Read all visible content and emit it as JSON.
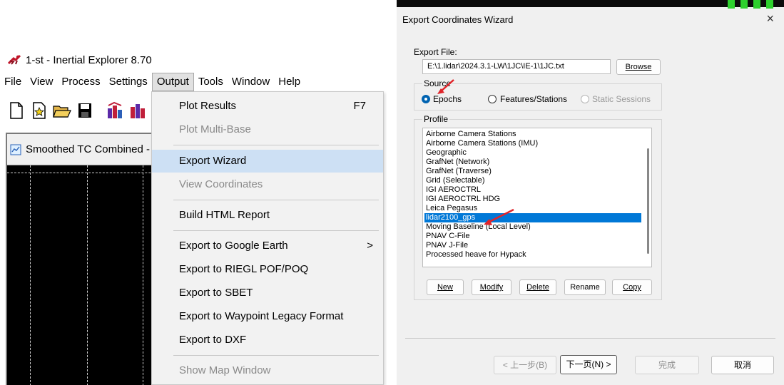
{
  "left": {
    "app_title": "1-st - Inertial Explorer 8.70",
    "menubar": [
      "File",
      "View",
      "Process",
      "Settings",
      "Output",
      "Tools",
      "Window",
      "Help"
    ],
    "active_menu": "Output",
    "doc_window_title": "Smoothed TC Combined - M",
    "dropdown": {
      "items": [
        {
          "label": "Plot Results",
          "shortcut": "F7",
          "enabled": true
        },
        {
          "label": "Plot Multi-Base",
          "enabled": false
        },
        {
          "label": "Export Wizard",
          "enabled": true,
          "highlighted": true
        },
        {
          "label": "View Coordinates",
          "enabled": false
        },
        {
          "label": "Build HTML Report",
          "enabled": true
        },
        {
          "label": "Export to Google Earth",
          "enabled": true,
          "submenu": ">"
        },
        {
          "label": "Export to RIEGL POF/POQ",
          "enabled": true
        },
        {
          "label": "Export to SBET",
          "enabled": true
        },
        {
          "label": "Export to Waypoint Legacy Format",
          "enabled": true
        },
        {
          "label": "Export to DXF",
          "enabled": true
        },
        {
          "label": "Show Map Window",
          "enabled": false
        }
      ]
    }
  },
  "right": {
    "dialog_title": "Export Coordinates Wizard",
    "close_symbol": "×",
    "export_file_label": "Export File:",
    "export_file_value": "E:\\1.lidar\\2024.3.1-LW\\1JC\\IE-1\\1JC.txt",
    "browse_button": "Browse",
    "source_label": "Source",
    "source_options": [
      {
        "label": "Epochs",
        "selected": true,
        "enabled": true
      },
      {
        "label": "Features/Stations",
        "selected": false,
        "enabled": true
      },
      {
        "label": "Static Sessions",
        "selected": false,
        "enabled": false
      }
    ],
    "profile_label": "Profile",
    "profiles": [
      "Airborne Camera Stations",
      "Airborne Camera Stations (IMU)",
      "Geographic",
      "GrafNet (Network)",
      "GrafNet (Traverse)",
      "Grid (Selectable)",
      "IGI AEROCTRL",
      "IGI AEROCTRL HDG",
      "Leica Pegasus",
      "lidar2100_gps",
      "Moving Baseline (Local Level)",
      "PNAV C-File",
      "PNAV J-File",
      "Processed heave for Hypack"
    ],
    "selected_profile": "lidar2100_gps",
    "profile_buttons": [
      "New",
      "Modify",
      "Delete",
      "Rename",
      "Copy"
    ],
    "nav_buttons": {
      "back": "< 上一步(B)",
      "next": "下一页(N) >",
      "finish": "完成",
      "cancel": "取消"
    },
    "colors": {
      "selection_blue": "#0078d7",
      "menu_highlight": "#cde0f4",
      "annotation_red": "#e0242a",
      "status_green": "#2ed12e"
    }
  }
}
